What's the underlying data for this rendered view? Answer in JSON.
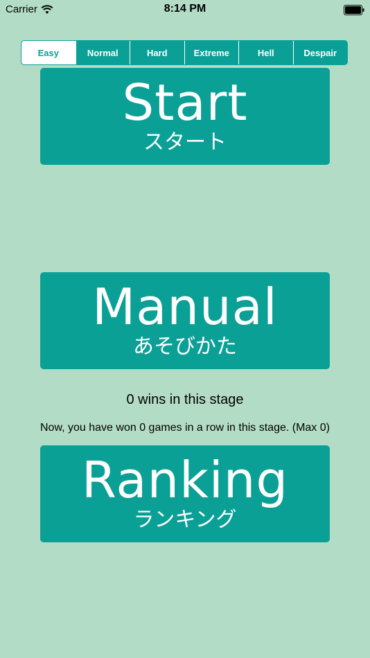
{
  "status_bar": {
    "carrier": "Carrier",
    "time": "8:14 PM",
    "wifi_icon": "wifi-icon",
    "battery_icon": "battery-icon"
  },
  "difficulty": {
    "selected": "Easy",
    "options": [
      "Easy",
      "Normal",
      "Hard",
      "Extreme",
      "Hell",
      "Despair"
    ]
  },
  "buttons": {
    "start": {
      "label": "Start",
      "sub": "スタート"
    },
    "manual": {
      "label": "Manual",
      "sub": "あそびかた"
    },
    "ranking": {
      "label": "Ranking",
      "sub": "ランキング"
    }
  },
  "stats": {
    "wins": "0 wins in this stage",
    "streak": "Now, you have won 0 games in a row in this stage. (Max 0)"
  },
  "colors": {
    "background": "#b3dcc6",
    "accent": "#0aa096",
    "text_on_accent": "#ffffff"
  }
}
